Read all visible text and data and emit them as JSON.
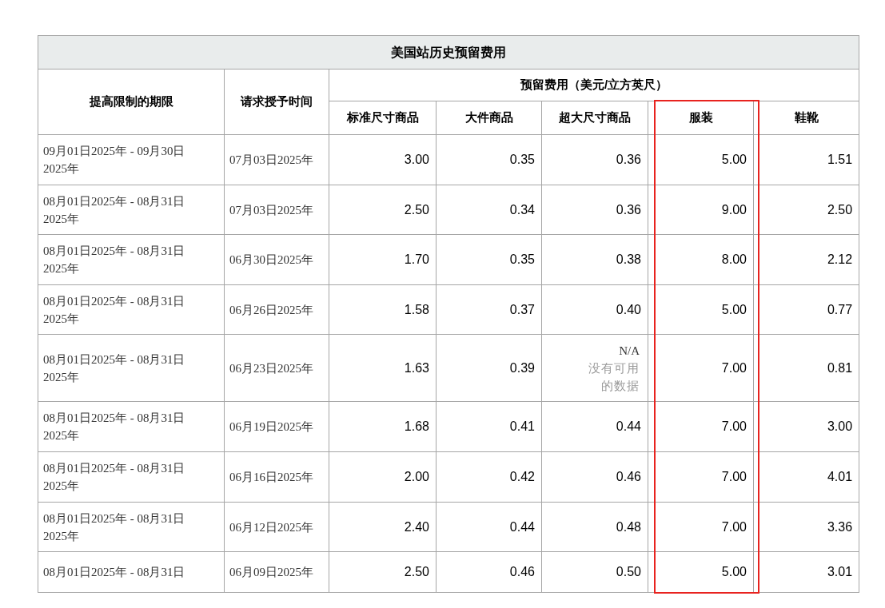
{
  "title": "美国站历史预留费用",
  "header": {
    "period": "提高限制的期限",
    "granted": "请求授予时间",
    "fees_group": "预留费用（美元/立方英尺）",
    "columns": [
      {
        "label": "标准尺寸商品",
        "highlighted": false
      },
      {
        "label": "大件商品",
        "highlighted": false
      },
      {
        "label": "超大尺寸商品",
        "highlighted": false
      },
      {
        "label": "服装",
        "highlighted": true
      },
      {
        "label": "鞋靴",
        "highlighted": false
      }
    ]
  },
  "rows": [
    {
      "period": "09月01日2025年 - 09月30日 2025年",
      "granted": "07月03日2025年",
      "values": [
        {
          "kind": "number",
          "text": "3.00"
        },
        {
          "kind": "number",
          "text": "0.35"
        },
        {
          "kind": "number",
          "text": "0.36"
        },
        {
          "kind": "number",
          "text": "5.00"
        },
        {
          "kind": "number",
          "text": "1.51"
        }
      ]
    },
    {
      "period": "08月01日2025年 - 08月31日 2025年",
      "granted": "07月03日2025年",
      "values": [
        {
          "kind": "number",
          "text": "2.50"
        },
        {
          "kind": "number",
          "text": "0.34"
        },
        {
          "kind": "number",
          "text": "0.36"
        },
        {
          "kind": "number",
          "text": "9.00"
        },
        {
          "kind": "number",
          "text": "2.50"
        }
      ]
    },
    {
      "period": "08月01日2025年 - 08月31日 2025年",
      "granted": "06月30日2025年",
      "values": [
        {
          "kind": "number",
          "text": "1.70"
        },
        {
          "kind": "number",
          "text": "0.35"
        },
        {
          "kind": "number",
          "text": "0.38"
        },
        {
          "kind": "number",
          "text": "8.00"
        },
        {
          "kind": "number",
          "text": "2.12"
        }
      ]
    },
    {
      "period": "08月01日2025年 - 08月31日 2025年",
      "granted": "06月26日2025年",
      "values": [
        {
          "kind": "number",
          "text": "1.58"
        },
        {
          "kind": "number",
          "text": "0.37"
        },
        {
          "kind": "number",
          "text": "0.40"
        },
        {
          "kind": "number",
          "text": "5.00"
        },
        {
          "kind": "number",
          "text": "0.77"
        }
      ]
    },
    {
      "period": "08月01日2025年 - 08月31日 2025年",
      "granted": "06月23日2025年",
      "values": [
        {
          "kind": "number",
          "text": "1.63"
        },
        {
          "kind": "number",
          "text": "0.39"
        },
        {
          "kind": "na",
          "text": "N/A",
          "note": "没有可用的数据"
        },
        {
          "kind": "number",
          "text": "7.00"
        },
        {
          "kind": "number",
          "text": "0.81"
        }
      ]
    },
    {
      "period": "08月01日2025年 - 08月31日 2025年",
      "granted": "06月19日2025年",
      "values": [
        {
          "kind": "number",
          "text": "1.68"
        },
        {
          "kind": "number",
          "text": "0.41"
        },
        {
          "kind": "number",
          "text": "0.44"
        },
        {
          "kind": "number",
          "text": "7.00"
        },
        {
          "kind": "number",
          "text": "3.00"
        }
      ]
    },
    {
      "period": "08月01日2025年 - 08月31日 2025年",
      "granted": "06月16日2025年",
      "values": [
        {
          "kind": "number",
          "text": "2.00"
        },
        {
          "kind": "number",
          "text": "0.42"
        },
        {
          "kind": "number",
          "text": "0.46"
        },
        {
          "kind": "number",
          "text": "7.00"
        },
        {
          "kind": "number",
          "text": "4.01"
        }
      ]
    },
    {
      "period": "08月01日2025年 - 08月31日 2025年",
      "granted": "06月12日2025年",
      "values": [
        {
          "kind": "number",
          "text": "2.40"
        },
        {
          "kind": "number",
          "text": "0.44"
        },
        {
          "kind": "number",
          "text": "0.48"
        },
        {
          "kind": "number",
          "text": "7.00"
        },
        {
          "kind": "number",
          "text": "3.36"
        }
      ]
    },
    {
      "period": "08月01日2025年 - 08月31日",
      "granted": "06月09日2025年",
      "values": [
        {
          "kind": "number",
          "text": "2.50"
        },
        {
          "kind": "number",
          "text": "0.46"
        },
        {
          "kind": "number",
          "text": "0.50"
        },
        {
          "kind": "number",
          "text": "5.00"
        },
        {
          "kind": "number",
          "text": "3.01"
        }
      ]
    }
  ]
}
